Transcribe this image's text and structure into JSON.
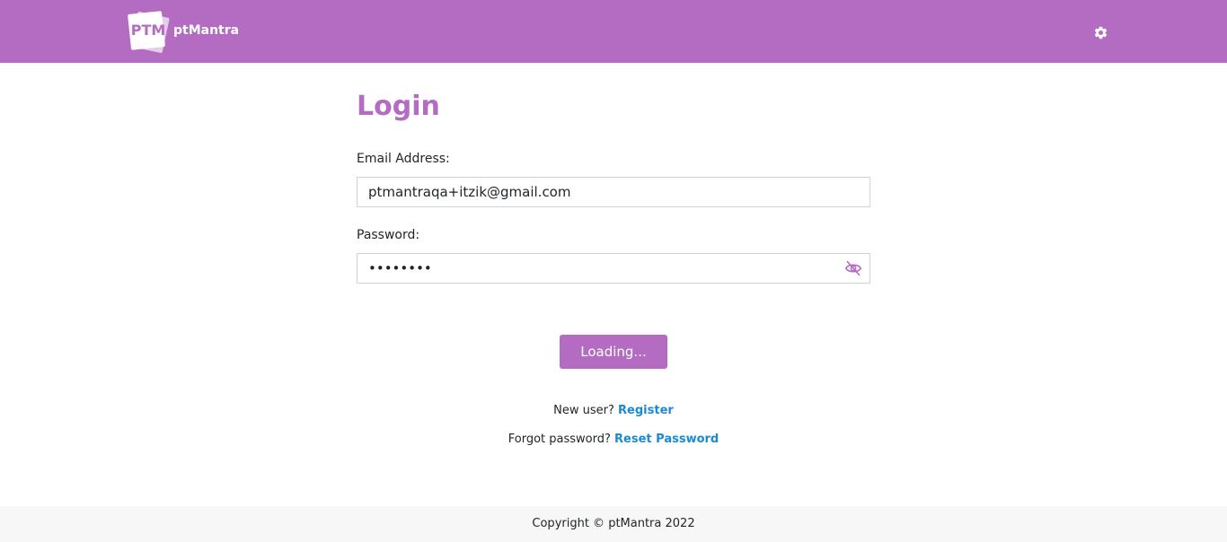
{
  "header": {
    "logo_mark": "PTM",
    "brand": "ptMantra",
    "settings_icon": "gear-icon",
    "bg_color": "#b36cc1"
  },
  "login": {
    "title": "Login",
    "email_label": "Email Address:",
    "email_value": "ptmantraqa+itzik@gmail.com",
    "password_label": "Password:",
    "password_value": "••••••••",
    "password_toggle_icon": "eye-off-icon",
    "submit_label": "Loading...",
    "new_user_text": "New user?",
    "register_link": "Register",
    "forgot_text": "Forgot password?",
    "reset_link": "Reset Password"
  },
  "footer": {
    "copyright": "Copyright © ptMantra 2022"
  },
  "colors": {
    "accent": "#b36cc1",
    "link": "#1a8ad4"
  }
}
